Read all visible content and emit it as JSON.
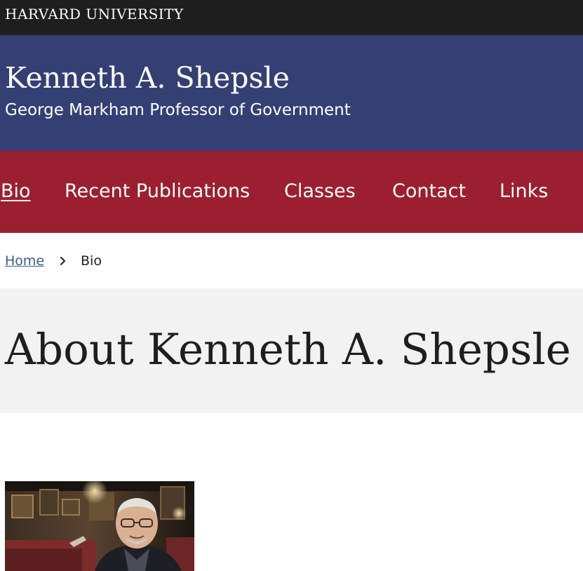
{
  "top_bar": {
    "university": "HARVARD UNIVERSITY"
  },
  "header": {
    "title": "Kenneth A. Shepsle",
    "subtitle": "George Markham Professor of Government"
  },
  "nav": {
    "items": [
      {
        "label": "Bio",
        "active": true
      },
      {
        "label": "Recent Publications",
        "active": false
      },
      {
        "label": "Classes",
        "active": false
      },
      {
        "label": "Contact",
        "active": false
      },
      {
        "label": "Links",
        "active": false
      }
    ]
  },
  "breadcrumb": {
    "home": "Home",
    "separator_icon": "chevron-right-icon",
    "current": "Bio"
  },
  "page": {
    "title": "About Kenneth A. Shepsle"
  },
  "photo": {
    "subject": "portrait"
  },
  "colors": {
    "top_bar": "#1e1e1e",
    "header": "#344073",
    "nav": "#9b1f31",
    "link": "#3d5a8a",
    "title_band": "#f2f2f2"
  }
}
